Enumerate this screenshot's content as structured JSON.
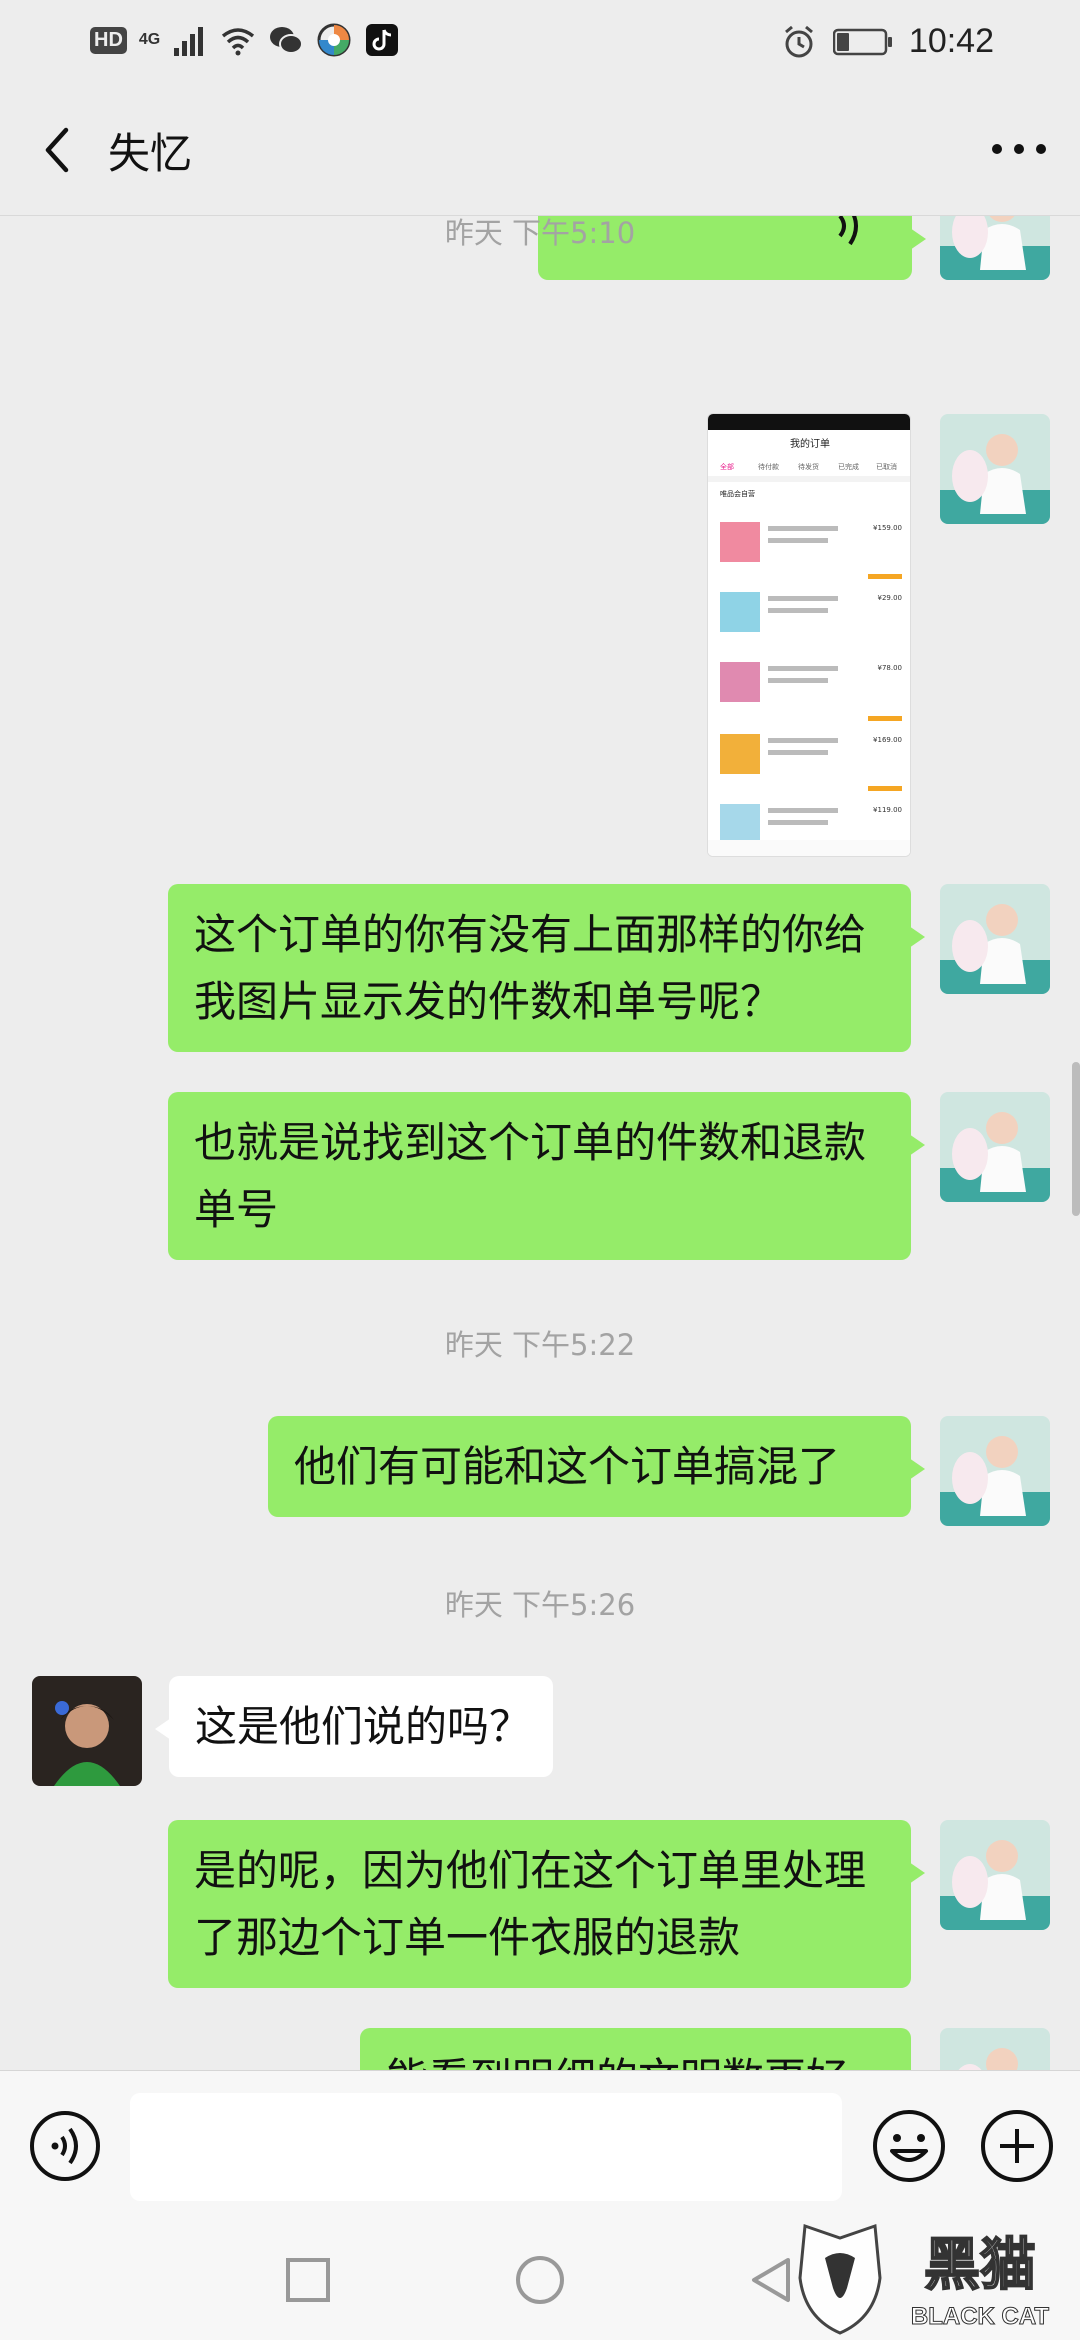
{
  "status_bar": {
    "hd": "HD",
    "network": "4G",
    "time": "10:42"
  },
  "header": {
    "title": "失忆"
  },
  "timestamps": [
    "昨天 下午5:10",
    "昨天 下午5:22",
    "昨天 下午5:26"
  ],
  "messages": [
    {
      "side": "me",
      "text": "这个订单的你有没有上面那样的你给我图片显示发的件数和单号呢？"
    },
    {
      "side": "me",
      "text": "也就是说找到这个订单的件数和退款单号"
    },
    {
      "side": "me",
      "text": "他们有可能和这个订单搞混了"
    },
    {
      "side": "other",
      "text": "这是他们说的吗？"
    },
    {
      "side": "me",
      "text": "是的呢，因为他们在这个订单里处理了那边个订单一件衣服的退款"
    },
    {
      "side": "me",
      "text": "能看到明细的文明数更好"
    }
  ],
  "screenshot_thumb": {
    "title": "我的订单",
    "tabs": [
      "全部",
      "待付款",
      "待发货",
      "已完成",
      "已取消"
    ],
    "store": "唯品会自营",
    "prices": [
      "¥159.00",
      "¥29.00",
      "¥78.00",
      "¥169.00",
      "¥119.00"
    ]
  },
  "input": {
    "placeholder": ""
  },
  "watermark": {
    "cn": "黑猫",
    "en": "BLACK CAT"
  },
  "colors": {
    "my_bubble": "#95ec69",
    "other_bubble": "#ffffff",
    "background": "#ededed"
  }
}
